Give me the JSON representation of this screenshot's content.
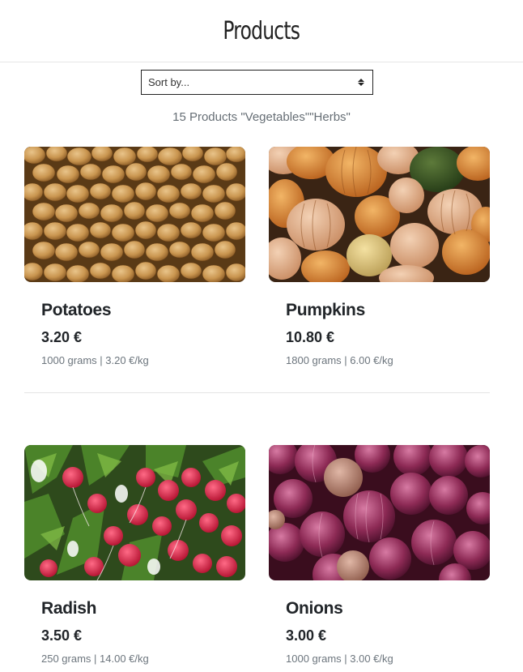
{
  "header": {
    "title": "Products"
  },
  "sort": {
    "label": "Sort by..."
  },
  "result_count": "15 Products \"Vegetables\"\"Herbs\"",
  "products": [
    {
      "name": "Potatoes",
      "price": "3.20 €",
      "unit": "1000 grams | 3.20 €/kg",
      "image": "potatoes-photo"
    },
    {
      "name": "Pumpkins",
      "price": "10.80 €",
      "unit": "1800 grams | 6.00 €/kg",
      "image": "pumpkins-photo"
    },
    {
      "name": "Radish",
      "price": "3.50 €",
      "unit": "250 grams | 14.00 €/kg",
      "image": "radish-photo"
    },
    {
      "name": "Onions",
      "price": "3.00 €",
      "unit": "1000 grams | 3.00 €/kg",
      "image": "onions-photo"
    }
  ]
}
